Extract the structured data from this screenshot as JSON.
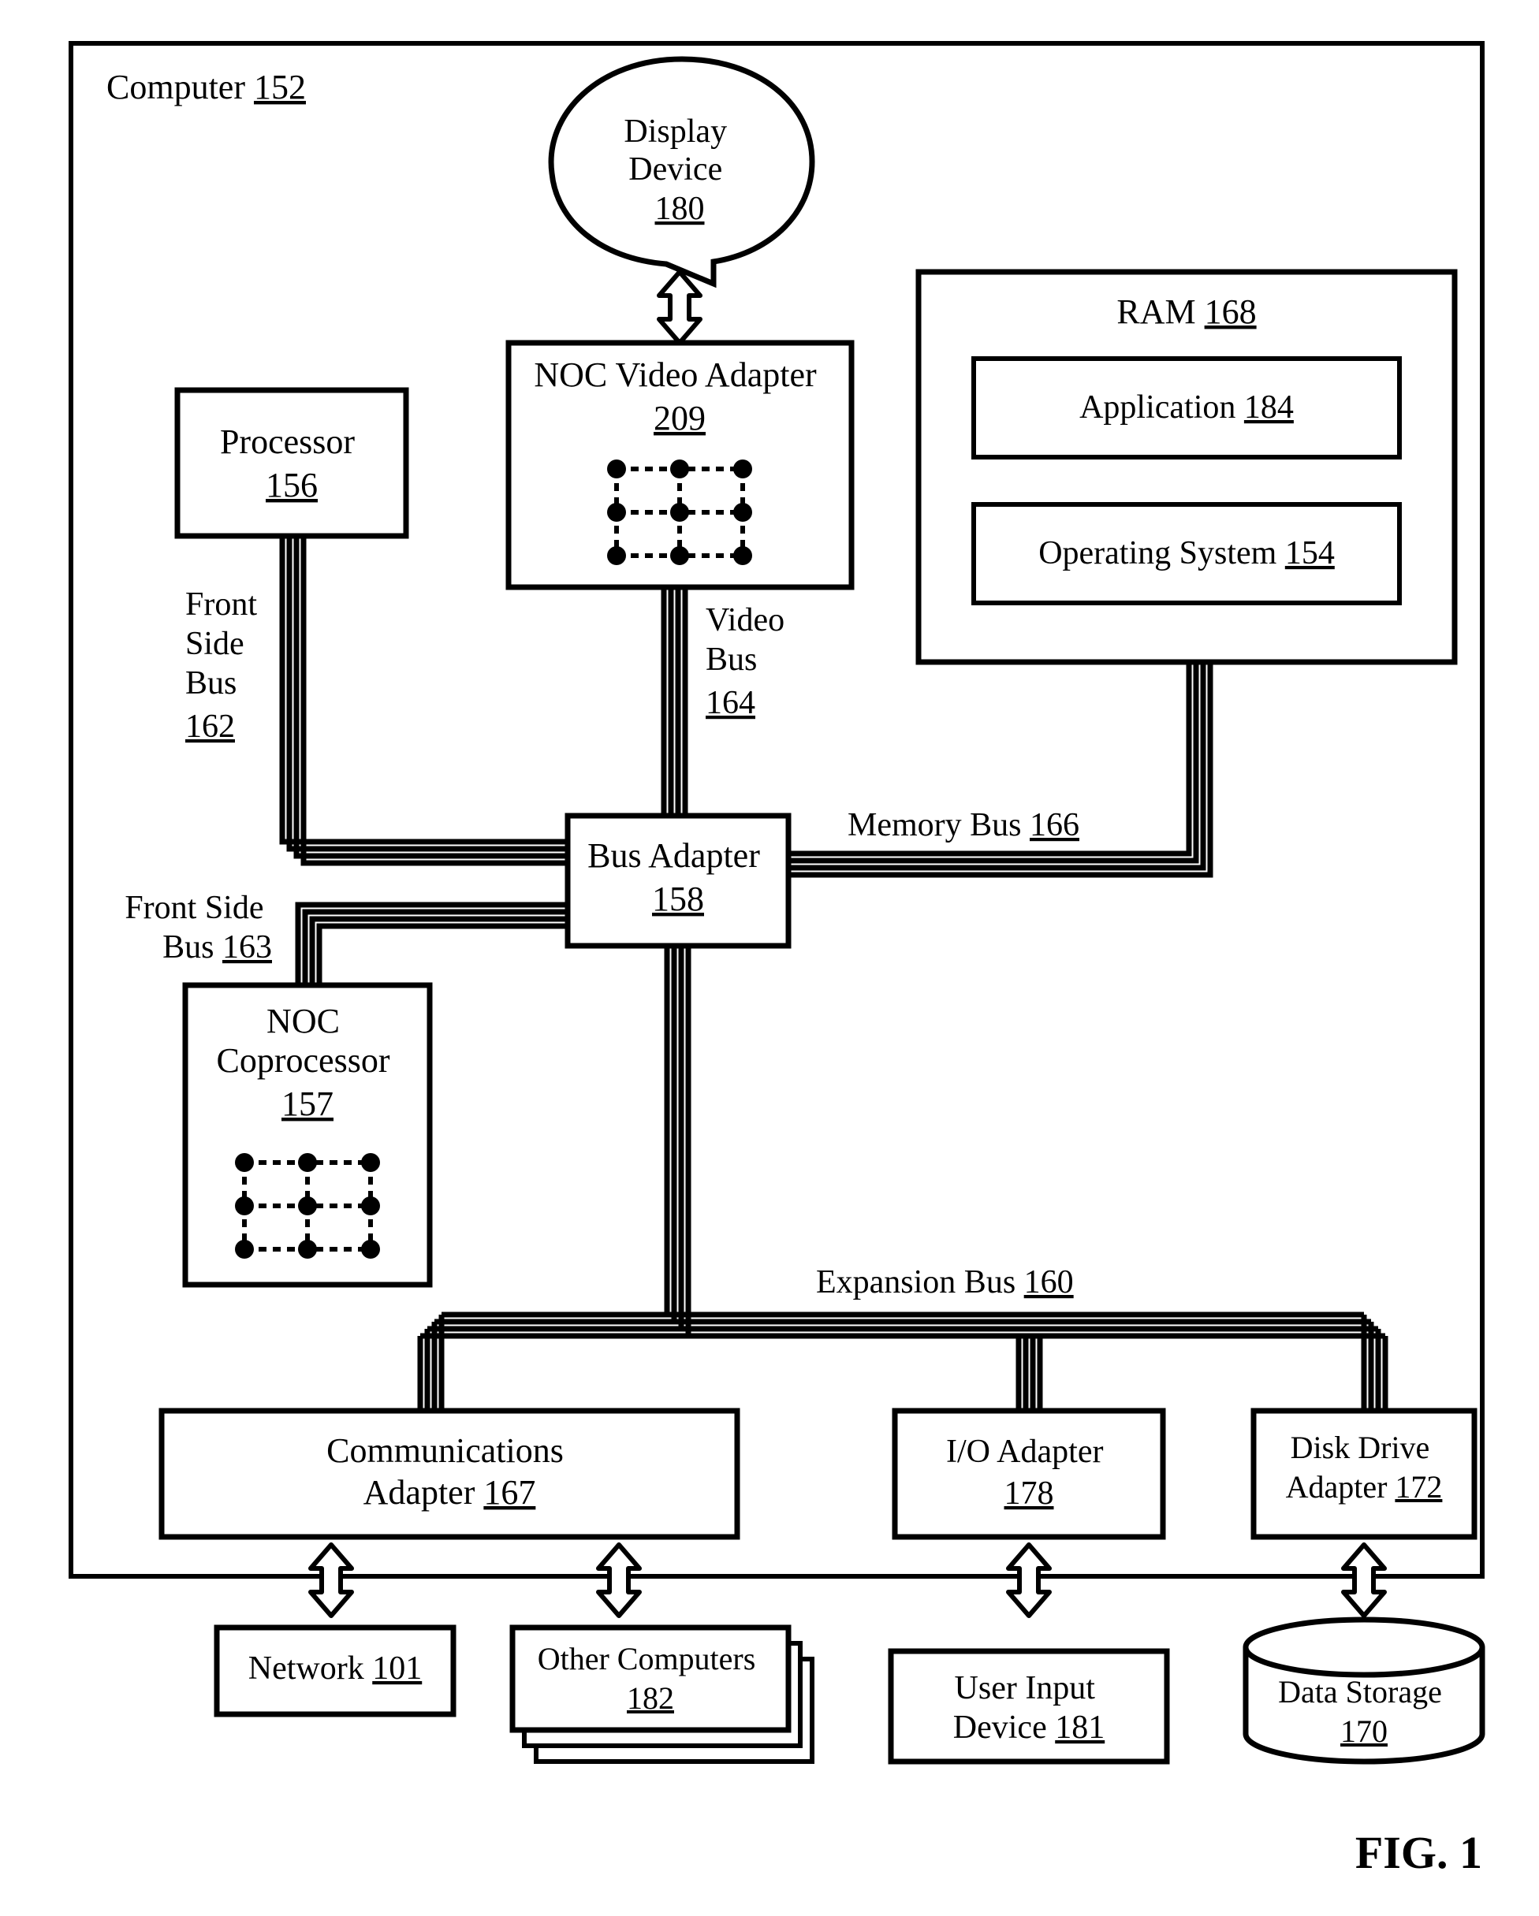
{
  "figure_label": "FIG. 1",
  "computer": {
    "label": "Computer",
    "ref": "152"
  },
  "display_device": {
    "label_line1": "Display",
    "label_line2": "Device",
    "ref": "180"
  },
  "noc_video_adapter": {
    "label": "NOC Video Adapter",
    "ref": "209"
  },
  "processor": {
    "label": "Processor",
    "ref": "156"
  },
  "ram": {
    "label": "RAM",
    "ref": "168"
  },
  "application": {
    "label": "Application",
    "ref": "184"
  },
  "operating_system": {
    "label": "Operating System",
    "ref": "154"
  },
  "bus_adapter": {
    "label": "Bus Adapter",
    "ref": "158"
  },
  "noc_coprocessor": {
    "label_line1": "NOC",
    "label_line2": "Coprocessor",
    "ref": "157"
  },
  "communications_adapter": {
    "label_line1": "Communications",
    "label_line2": "Adapter",
    "ref": "167"
  },
  "io_adapter": {
    "label": "I/O Adapter",
    "ref": "178"
  },
  "disk_drive_adapter": {
    "label_line1": "Disk Drive",
    "label_line2": "Adapter",
    "ref": "172"
  },
  "network": {
    "label": "Network",
    "ref": "101"
  },
  "other_computers": {
    "label_line1": "Other Computers",
    "ref": "182"
  },
  "user_input_device": {
    "label_line1": "User Input",
    "label_line2": "Device",
    "ref": "181"
  },
  "data_storage": {
    "label_line1": "Data Storage",
    "ref": "170"
  },
  "buses": {
    "front_side_bus": {
      "label_line1": "Front",
      "label_line2": "Side",
      "label_line3": "Bus",
      "ref": "162"
    },
    "video_bus": {
      "label_line1": "Video",
      "label_line2": "Bus",
      "ref": "164"
    },
    "memory_bus": {
      "label": "Memory Bus",
      "ref": "166"
    },
    "front_side_bus_2": {
      "label_line1": "Front Side",
      "label_line2": "Bus",
      "ref": "163"
    },
    "expansion_bus": {
      "label": "Expansion Bus",
      "ref": "160"
    }
  }
}
